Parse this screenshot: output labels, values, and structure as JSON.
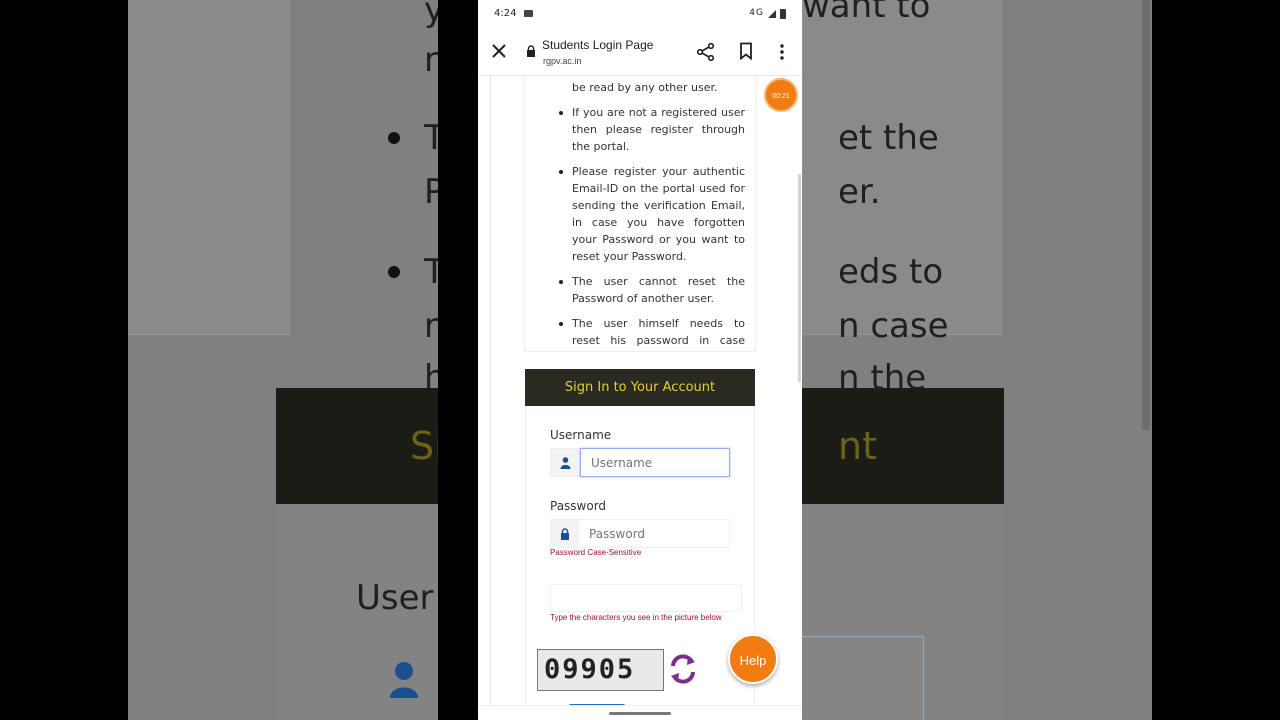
{
  "status_bar": {
    "time": "4:24",
    "network": "4G"
  },
  "browser": {
    "page_title": "Students Login Page",
    "url": "rgpv.ac.in"
  },
  "notes": {
    "items": [
      "encrypted format and cannot be read by any other user.",
      "If you are not a registered user then please register through the portal.",
      "Please register your authentic Email-ID on the portal used for sending the verification Email, in case you have forgotten your Password or you want to reset your Password.",
      "The user cannot reset the Password of another user.",
      "The user himself needs to reset his password in case he/she has forgotten the"
    ]
  },
  "login": {
    "heading": "Sign In to Your Account",
    "username_label": "Username",
    "username_placeholder": "Username",
    "password_label": "Password",
    "password_placeholder": "Password",
    "password_hint": "Password Case-Sensitive",
    "captcha_hint": "Type the characters you see in the picture below",
    "captcha_text": "09905"
  },
  "help_label": "Help",
  "timer": "00:21",
  "background_zoom": {
    "left_fragments": [
      "y",
      "r",
      "T",
      "P",
      "T",
      "r",
      "h",
      "Si",
      "User"
    ],
    "right_fragments": [
      "want to",
      "et  the",
      "er.",
      "eds  to",
      "n  case",
      "n  the",
      "nt"
    ]
  },
  "colors": {
    "header_bg": "#2a2a22",
    "header_text": "#e6cf2e",
    "accent_orange": "#f07c12",
    "hint_red": "#a01032",
    "focus_blue": "#8fb4ea"
  }
}
